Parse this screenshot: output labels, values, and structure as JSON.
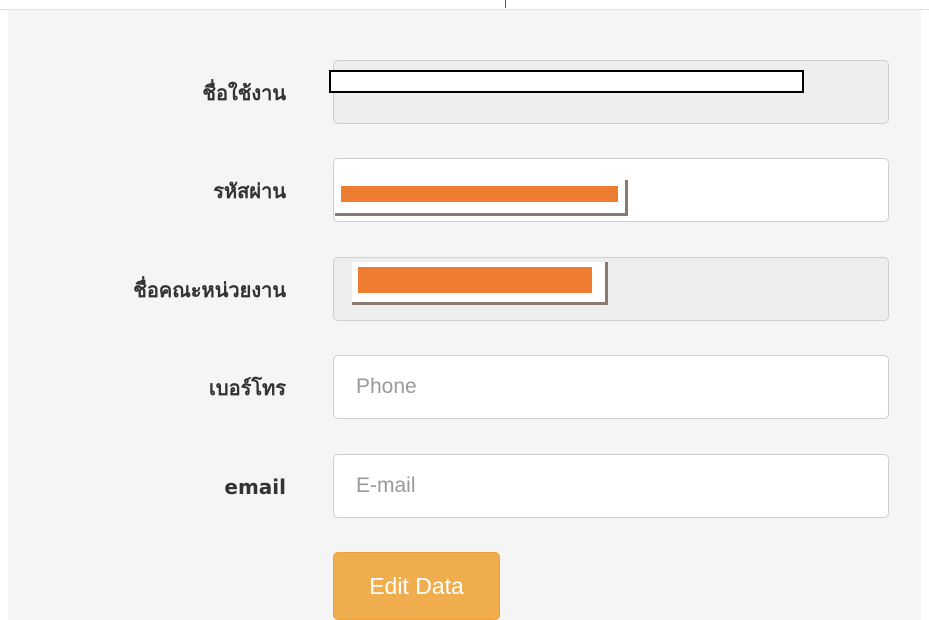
{
  "form": {
    "username": {
      "label": "ชื่อใช้งาน",
      "value": ""
    },
    "password": {
      "label": "รหัสผ่าน",
      "value": ""
    },
    "department": {
      "label": "ชื่อคณะหน่วยงาน",
      "value": ""
    },
    "phone": {
      "label": "เบอร์โทร",
      "placeholder": "Phone",
      "value": ""
    },
    "email": {
      "label": "email",
      "placeholder": "E-mail",
      "value": ""
    },
    "submit_label": "Edit Data"
  },
  "colors": {
    "button": "#f0ad4e",
    "redaction": "#ee7d31",
    "disabled_field": "#eeeeee"
  }
}
